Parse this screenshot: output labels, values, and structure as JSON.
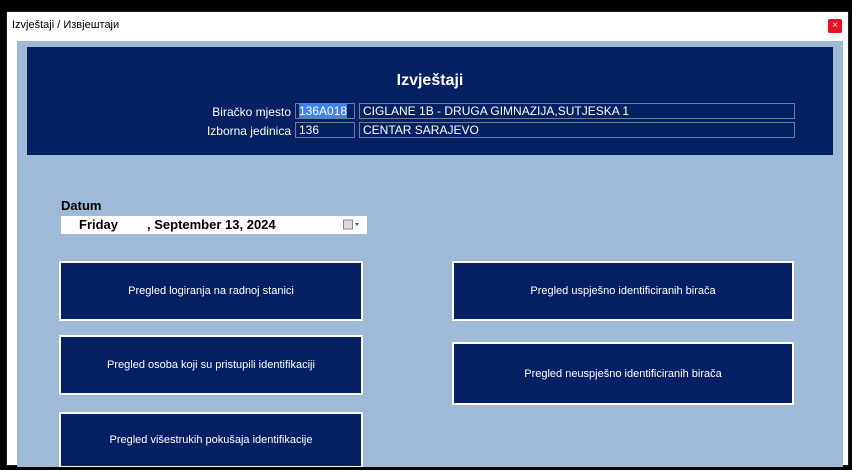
{
  "window": {
    "title": "Izvještaji / Извјештаји",
    "close_glyph": "×"
  },
  "header": {
    "title": "Izvještaji",
    "polling_station_label": "Biračko mjesto",
    "polling_station_code": "136A018",
    "polling_station_name": "CIGLANE 1B - DRUGA GIMNAZIJA,SUTJESKA 1",
    "electoral_unit_label": "Izborna jedinica",
    "electoral_unit_code": "136",
    "electoral_unit_name": "CENTAR SARAJEVO"
  },
  "date": {
    "label": "Datum",
    "day": "Friday",
    "rest": ", September 13, 2024",
    "icon": "calendar-dropdown-icon"
  },
  "buttons": {
    "login_review": "Pregled logiranja na radnoj stanici",
    "persons_review": "Pregled osoba koji su pristupili identifikaciji",
    "multiple_attempts": "Pregled višestrukih pokušaja identifikacije",
    "successful": "Pregled uspješno identificiranih birača",
    "unsuccessful": "Pregled neuspješno identificiranih birača"
  },
  "colors": {
    "panel": "#062064",
    "background": "#9fbad6",
    "selection": "#3b82f6",
    "close": "#e81123"
  }
}
